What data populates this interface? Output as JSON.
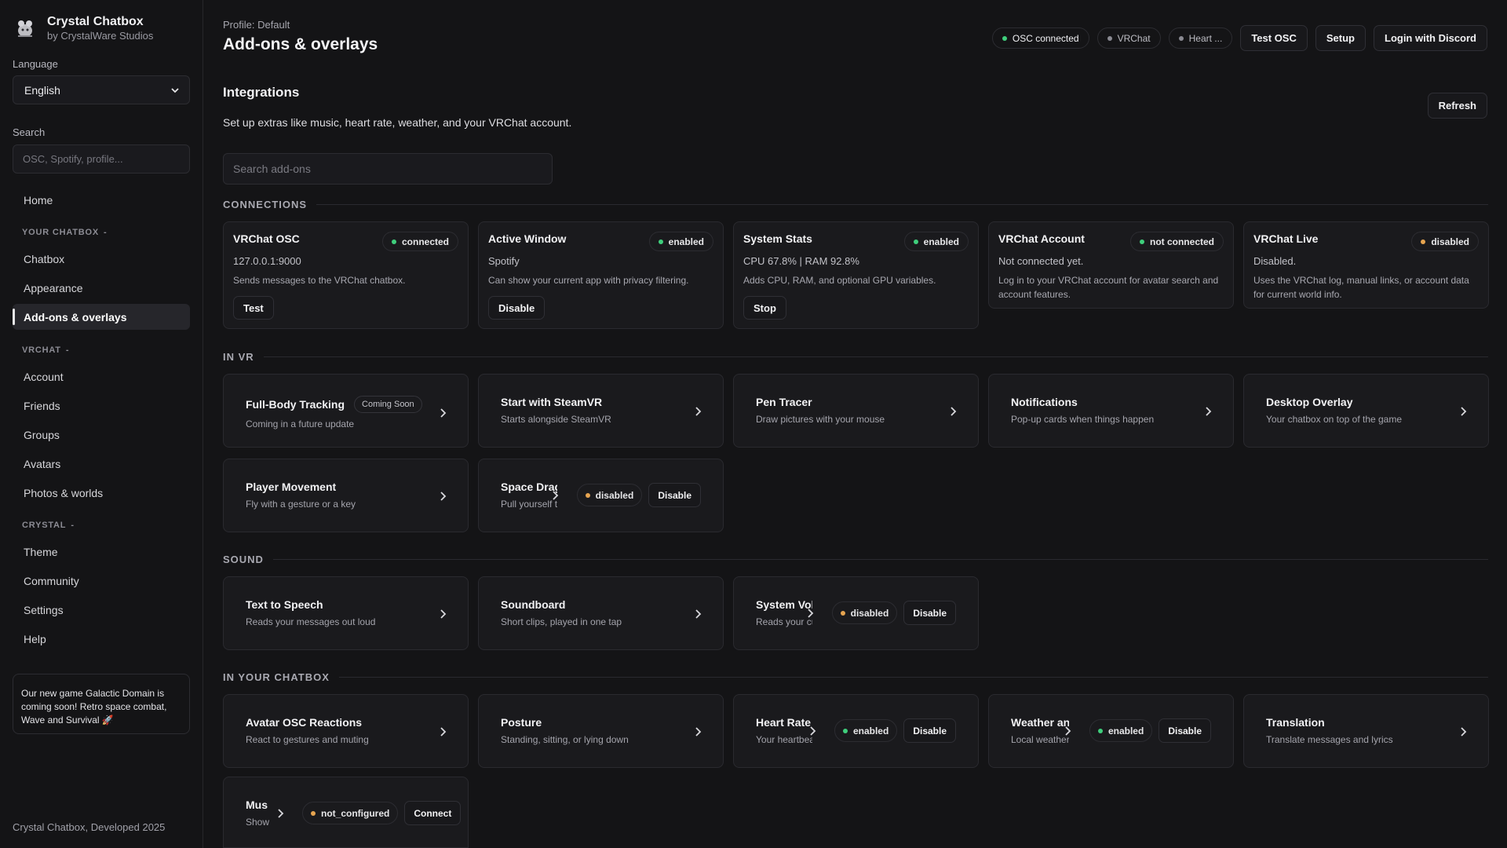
{
  "app": {
    "name": "Crystal Chatbox",
    "publisher": "by CrystalWare Studios",
    "footer": "Crystal Chatbox, Developed 2025"
  },
  "sidebar": {
    "language_label": "Language",
    "language_value": "English",
    "search_label": "Search",
    "search_placeholder": "OSC, Spotify, profile...",
    "home": "Home",
    "groups": {
      "your_chatbox": "YOUR CHATBOX",
      "vrchat": "VRCHAT",
      "crystal": "CRYSTAL",
      "collapse_glyph": "-"
    },
    "items": {
      "chatbox": "Chatbox",
      "appearance": "Appearance",
      "addons": "Add-ons & overlays",
      "account": "Account",
      "friends": "Friends",
      "groups": "Groups",
      "avatars": "Avatars",
      "photos": "Photos & worlds",
      "theme": "Theme",
      "community": "Community",
      "settings": "Settings",
      "help": "Help"
    },
    "promo": "Our new game Galactic Domain is coming soon! Retro space combat, Wave and Survival 🚀"
  },
  "header": {
    "breadcrumb": "Profile: Default",
    "title": "Add-ons & overlays",
    "status": {
      "osc": "OSC connected",
      "vrchat": "VRChat",
      "heart": "Heart ..."
    },
    "buttons": {
      "test_osc": "Test OSC",
      "setup": "Setup",
      "login": "Login with Discord"
    }
  },
  "integrations": {
    "title": "Integrations",
    "description": "Set up extras like music, heart rate, weather, and your VRChat account.",
    "refresh": "Refresh",
    "search_placeholder": "Search add-ons"
  },
  "sections": {
    "connections": "CONNECTIONS",
    "in_vr": "IN VR",
    "sound": "SOUND",
    "in_chatbox": "IN YOUR CHATBOX"
  },
  "connections": {
    "vrchat_osc": {
      "title": "VRChat OSC",
      "status": "connected",
      "value": "127.0.0.1:9000",
      "desc": "Sends messages to the VRChat chatbox.",
      "button": "Test"
    },
    "active_window": {
      "title": "Active Window",
      "status": "enabled",
      "value": "Spotify",
      "desc": "Can show your current app with privacy filtering.",
      "button": "Disable"
    },
    "system_stats": {
      "title": "System Stats",
      "status": "enabled",
      "value": "CPU 67.8% | RAM 92.8%",
      "desc": "Adds CPU, RAM, and optional GPU variables.",
      "button": "Stop"
    },
    "vrchat_account": {
      "title": "VRChat Account",
      "status": "not connected",
      "value": "Not connected yet.",
      "desc": "Log in to your VRChat account for avatar search and account features."
    },
    "vrchat_live": {
      "title": "VRChat Live",
      "status": "disabled",
      "value": "Disabled.",
      "desc": "Uses the VRChat log, manual links, or account data for current world info."
    }
  },
  "in_vr": {
    "fbt": {
      "title": "Full-Body Tracking",
      "badge": "Coming Soon",
      "sub": "Coming in a future update"
    },
    "steamvr": {
      "title": "Start with SteamVR",
      "sub": "Starts alongside SteamVR"
    },
    "pen": {
      "title": "Pen Tracer",
      "sub": "Draw pictures with your mouse"
    },
    "notifications": {
      "title": "Notifications",
      "sub": "Pop-up cards when things happen"
    },
    "desktop": {
      "title": "Desktop Overlay",
      "sub": "Your chatbox on top of the game"
    },
    "movement": {
      "title": "Player Movement",
      "sub": "Fly with a gesture or a key"
    },
    "space_drag": {
      "title": "Space Drag",
      "sub": "Pull yourself t",
      "status": "disabled",
      "button": "Disable"
    }
  },
  "sound": {
    "tts": {
      "title": "Text to Speech",
      "sub": "Reads your messages out loud"
    },
    "soundboard": {
      "title": "Soundboard",
      "sub": "Short clips, played in one tap"
    },
    "system_volume": {
      "title": "System Vol",
      "sub": "Reads your cu",
      "status": "disabled",
      "button": "Disable"
    }
  },
  "chatbox": {
    "avatar_osc": {
      "title": "Avatar OSC Reactions",
      "sub": "React to gestures and muting"
    },
    "posture": {
      "title": "Posture",
      "sub": "Standing, sitting, or lying down"
    },
    "heart_rate": {
      "title": "Heart Rate",
      "sub": "Your heartbea",
      "status": "enabled",
      "button": "Disable"
    },
    "weather": {
      "title": "Weather an",
      "sub": "Local weather",
      "status": "enabled",
      "button": "Disable"
    },
    "translation": {
      "title": "Translation",
      "sub": "Translate messages and lyrics"
    },
    "music": {
      "title": "Mus",
      "sub": "Show",
      "status": "not_configured",
      "button": "Connect"
    }
  },
  "colors": {
    "background": "#141416",
    "card": "#1a1a1d",
    "border": "#2a2a2f",
    "status_green": "#3fcf7c",
    "status_amber": "#e6a450",
    "status_gray": "#8a8a92"
  }
}
